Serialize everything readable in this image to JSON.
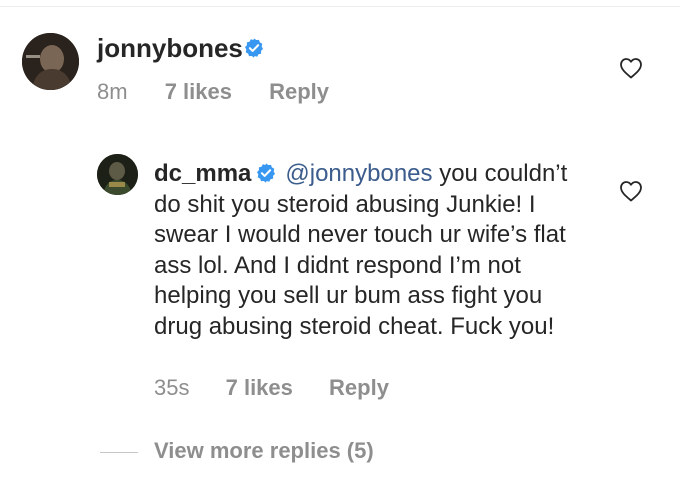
{
  "comment": {
    "username": "jonnybones",
    "verified": true,
    "time": "8m",
    "likes": "7 likes",
    "reply_label": "Reply"
  },
  "reply": {
    "username": "dc_mma",
    "verified": true,
    "mention": "@jonnybones",
    "text": " you couldn’t do shit you steroid abusing Junkie! I swear I would never touch ur wife’s flat ass lol. And I didnt respond I’m not helping you sell ur bum ass fight you drug abusing steroid cheat. Fuck you!",
    "time": "35s",
    "likes": "7 likes",
    "reply_label": "Reply"
  },
  "view_more_replies": "View more replies (5)",
  "colors": {
    "verified_badge": "#3897f0",
    "mention": "#3b5c8c",
    "muted": "#8e8e8e"
  },
  "icons": {
    "like": "heart-outline-icon",
    "verified": "verified-badge-icon"
  }
}
